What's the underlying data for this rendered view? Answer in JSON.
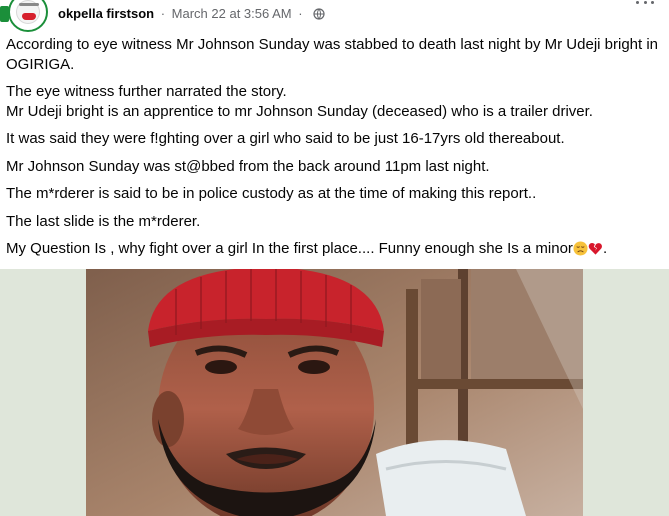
{
  "post": {
    "author": "okpella firstson",
    "separator": "·",
    "timestamp": "March 22 at 3:56 AM",
    "privacy_icon": "globe-icon",
    "more_icon": "more-options-icon",
    "paragraphs": [
      "According to eye witness Mr Johnson Sunday was stabbed to death last night by Mr Udeji bright in OGIRIGA.",
      "The eye witness further narrated the story.",
      "Mr Udeji bright is an apprentice to mr Johnson Sunday (deceased) who is a trailer driver.",
      "It was said they were f!ghting over a girl who said to be just 16-17yrs old thereabout.",
      "Mr Johnson Sunday was st@bbed from the back around 11pm last night.",
      "The m*rderer is said to be in police custody as at the time of making this report..",
      "The last slide is the m*rderer.",
      "My Question Is , why fight over a girl In the first place.... Funny enough she Is a minor",
      "."
    ],
    "trailing_emojis": [
      "disappointed-face-emoji",
      "broken-heart-emoji"
    ]
  },
  "media": {
    "background": "#dfe6da",
    "subject": "close-up photo of a bearded man wearing a red knit cap"
  },
  "colors": {
    "text": "#050505",
    "meta": "#65676b",
    "avatar_ring": "#1b8f3a",
    "cap_red": "#c8232c"
  }
}
